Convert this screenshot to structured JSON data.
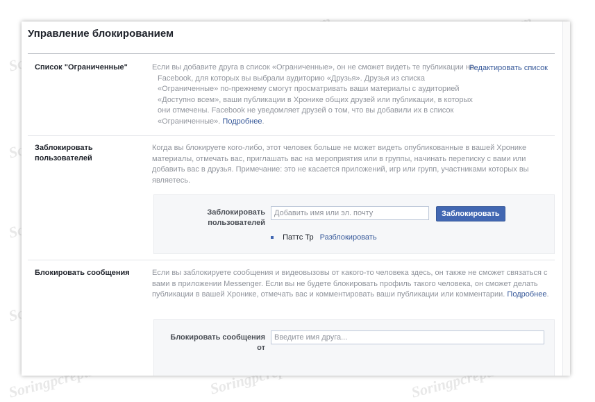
{
  "page_title": "Управление блокированием",
  "restricted": {
    "label": "Список \"Ограниченные\"",
    "desc_text": "Если вы добавите друга в список «Ограниченные», он не сможет видеть те публикации на Facebook, для которых вы выбрали аудиторию «Друзья». Друзья из списка «Ограниченные» по-прежнему смогут просматривать ваши материалы с аудиторией «Доступно всем», ваши публикации в Хронике общих друзей или публикации, в которых они отмечены. Facebook не уведомляет друзей о том, что вы добавили их в список «Ограниченные».",
    "more_link": "Подробнее",
    "edit_link": "Редактировать список"
  },
  "block_users": {
    "label": "Заблокировать пользователей",
    "desc_text": "Когда вы блокируете кого-либо, этот человек больше не может видеть опубликованные в вашей Хронике материалы, отмечать вас, приглашать вас на мероприятия или в группы, начинать переписку с вами или добавить вас в друзья. Примечание: это не касается приложений, игр или групп, участниками которых вы являетесь.",
    "field_label": "Заблокировать пользователей",
    "input_placeholder": "Добавить имя или эл. почту",
    "button_label": "Заблокировать",
    "blocked_list": [
      {
        "name": "Паттс Тр",
        "unblock_label": "Разблокировать"
      }
    ]
  },
  "block_messages": {
    "label": "Блокировать сообщения",
    "desc_text": "Если вы заблокируете сообщения и видеовызовы от какого-то человека здесь, он также не сможет связаться с вами в приложении Messenger. Если вы не будете блокировать профиль такого человека, он сможет делать публикации в вашей Хронике, отмечать вас и комментировать ваши публикации или комментарии.",
    "more_link": "Подробнее",
    "field_label": "Блокировать сообщения от",
    "input_placeholder": "Введите имя друга..."
  },
  "watermark_text": "Soringpcrepair.com",
  "colors": {
    "link": "#365899",
    "button": "#4267b2",
    "muted_text": "#90949c",
    "subbox_bg": "#f6f7f9"
  }
}
